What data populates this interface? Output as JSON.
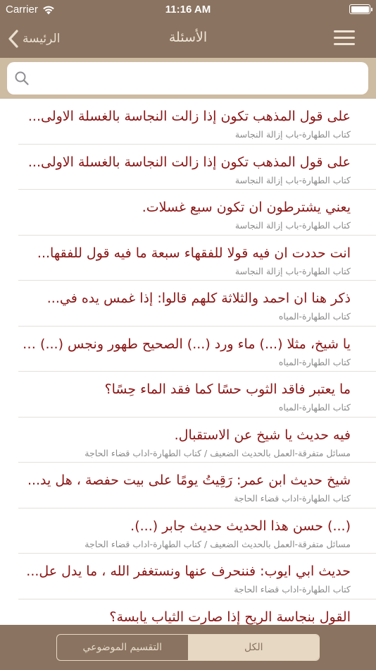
{
  "status_bar": {
    "carrier": "Carrier",
    "time": "11:16 AM"
  },
  "nav": {
    "back_label": "الرئيسة",
    "title": "الأسئلة"
  },
  "search": {
    "placeholder": ""
  },
  "questions": [
    {
      "title": "على قول المذهب تكون إذا زالت النجاسة بالغسلة الاولى...",
      "subtitle": "كتاب الطهارة-باب إزالة النجاسة"
    },
    {
      "title": "على قول المذهب تكون إذا زالت النجاسة بالغسلة الاولى...",
      "subtitle": "كتاب الطهارة-باب إزالة النجاسة"
    },
    {
      "title": "يعني يشترطون ان تكون سبع غسلات.",
      "subtitle": "كتاب الطهارة-باب إزالة النجاسة"
    },
    {
      "title": "انت حددت ان فيه قولا للفقهاء سبعة ما فيه قول للفقها...",
      "subtitle": "كتاب الطهارة-باب إزالة النجاسة"
    },
    {
      "title": "ذكر هنا ان احمد والثلاثة كلهم قالوا: إذا غمس يده في...",
      "subtitle": "كتاب الطهارة-المياه"
    },
    {
      "title": "يا شيخ، مثلا (...) ماء ورد (...) الصحيح طهور ونجس (...) ما...",
      "subtitle": "كتاب الطهارة-المياه"
    },
    {
      "title": "ما يعتبر فاقد الثوب حسًا كما فقد الماء حِسًا؟",
      "subtitle": "كتاب الطهارة-المياه"
    },
    {
      "title": "فيه حديث يا شيخ عن الاستقبال.",
      "subtitle": "مسائل متفرقة-العمل بالحديث الضعيف / كتاب الطهارة-اداب قضاء الحاجة"
    },
    {
      "title": "شيخ حديث ابن عمر: رَقِيتُ يومًا على بيت حفصة ، هل يد...",
      "subtitle": "كتاب الطهارة-اداب قضاء الحاجة"
    },
    {
      "title": "(...) حسن هذا الحديث حديث جابر (...).",
      "subtitle": "مسائل متفرقة-العمل بالحديث الضعيف / كتاب الطهارة-اداب قضاء الحاجة"
    },
    {
      "title": "حديث ابي ايوب: فننحرف عنها ونستغفر الله ، ما يدل عل...",
      "subtitle": "كتاب الطهارة-اداب قضاء الحاجة"
    },
    {
      "title": "القول بنجاسة الريح إذا صارت الثياب يابسة؟",
      "subtitle": ""
    }
  ],
  "segments": {
    "topic_label": "التقسيم الموضوعي",
    "all_label": "الكل",
    "selected": "all"
  },
  "colors": {
    "bar": "#8a7360",
    "search_band": "#cdbba2",
    "title_text": "#8b1515",
    "subtitle_text": "#8a8a8a",
    "segment_fill": "#e6d8c3"
  },
  "icons": [
    "wifi-icon",
    "battery-icon",
    "chevron-left-icon",
    "hamburger-menu-icon",
    "search-icon"
  ]
}
